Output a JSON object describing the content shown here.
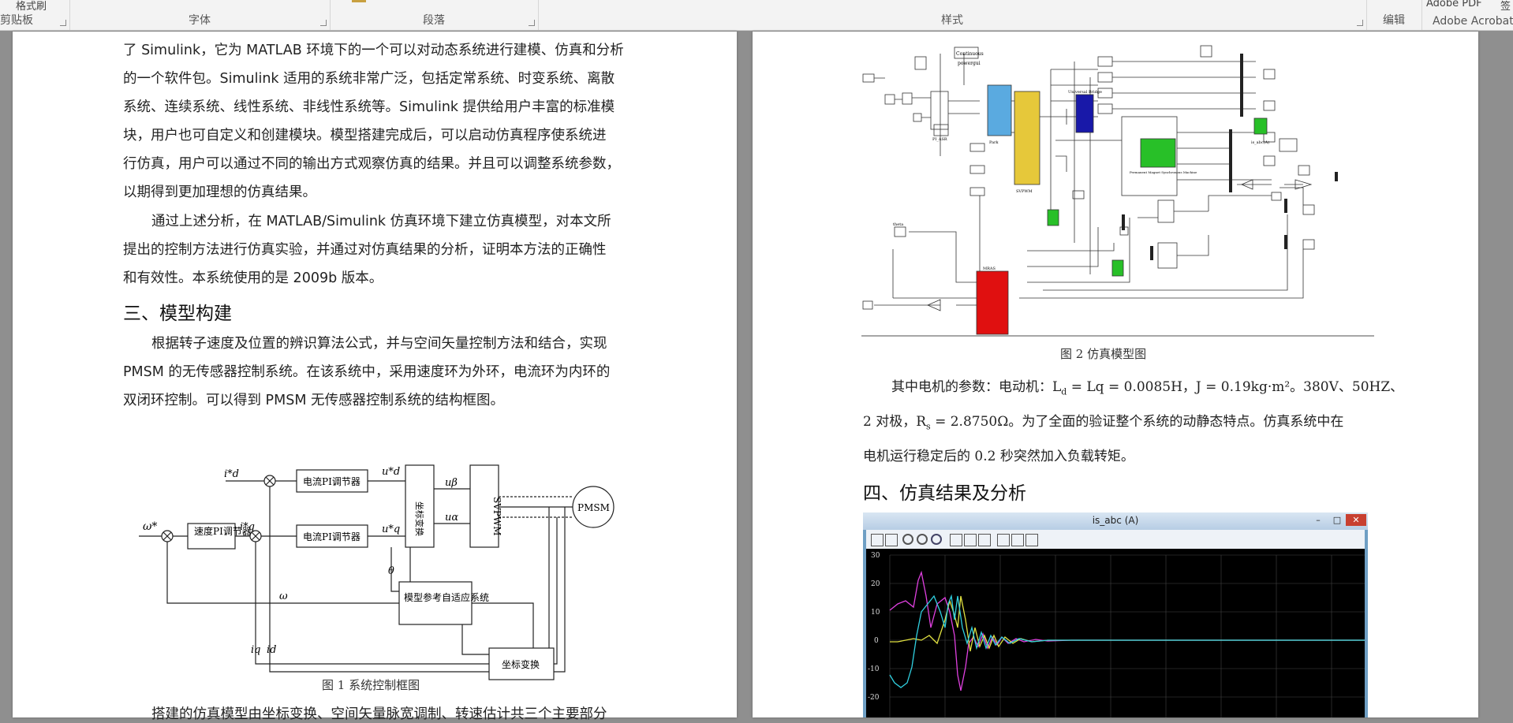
{
  "ribbon": {
    "groups": [
      {
        "label": "剪贴板"
      },
      {
        "label": "字体"
      },
      {
        "label": "段落"
      },
      {
        "label": "样式"
      },
      {
        "label": "编辑"
      },
      {
        "label": "Adobe Acrobat"
      }
    ],
    "top_fragments": [
      "格式刷",
      "Adobe PDF",
      "签"
    ]
  },
  "left_page": {
    "para1_lines": [
      "了 Simulink，它为 MATLAB 环境下的一个可以对动态系统进行建模、仿真和分析",
      "的一个软件包。Simulink 适用的系统非常广泛，包括定常系统、时变系统、离散",
      "系统、连续系统、线性系统、非线性系统等。Simulink 提供给用户丰富的标准模",
      "块，用户也可自定义和创建模块。模型搭建完成后，可以启动仿真程序使系统进",
      "行仿真，用户可以通过不同的输出方式观察仿真的结果。并且可以调整系统参数，",
      "以期得到更加理想的仿真结果。"
    ],
    "para2_lines": [
      "通过上述分析，在 MATLAB/Simulink 仿真环境下建立仿真模型，对本文所",
      "提出的控制方法进行仿真实验，并通过对仿真结果的分析，证明本方法的正确性",
      "和有效性。本系统使用的是 2009b 版本。"
    ],
    "heading3": "三、模型构建",
    "para3_lines": [
      "根据转子速度及位置的辨识算法公式，并与空间矢量控制方法和结合，实现",
      "PMSM 的无传感器控制系统。在该系统中，采用速度环为外环，电流环为内环的",
      "双闭环控制。可以得到 PMSM 无传感器控制系统的结构框图。"
    ],
    "diagram": {
      "speed_pi": "速度PI调节器",
      "current_pi": "电流PI调节器",
      "coord_transform": "坐标变换",
      "svpwm": "SVPWM",
      "pmsm": "PMSM",
      "mras": "模型参考自适应系统",
      "coord_transform2": "坐标变换"
    },
    "caption1": "图 1  系统控制框图",
    "bottom_line": "搭建的仿真模型由坐标变换、空间矢量脉宽调制、转速估计共三个主要部分"
  },
  "right_page": {
    "caption2": "图 2  仿真模型图",
    "param_line1": "其中电机的参数：电动机：L",
    "param_line1_rest": "= Lq = 0.0085H，J = 0.19kg·m²。380V、50HZ、",
    "param_line2": "2 对极，R",
    "param_line2_rest": "= 2.8750Ω。为了全面的验证整个系统的动静态特点。仿真系统中在",
    "param_line3": "电机运行稳定后的 0.2 秒突然加入负载转矩。",
    "heading4": "四、仿真结果及分析",
    "scope": {
      "title": "is_abc (A)",
      "yticks": [
        "30",
        "20",
        "10",
        "0",
        "-10",
        "-20"
      ]
    },
    "model": {
      "labels": [
        "Continuous",
        "powergui",
        "PI_ASR",
        "Park",
        "SVPWM",
        "DC",
        "Universal Bridge",
        "Permanent Magnet Synchronous Machine",
        "MRAS",
        "is_abc(A)",
        "N_eT",
        "Te",
        "theta"
      ]
    }
  },
  "colors": {
    "blue_block": "#5aaae0",
    "yellow_block": "#e6c83a",
    "navy_block": "#1818a8",
    "green_block": "#28c028",
    "red_block": "#e01010",
    "scope_magenta": "#e040e0",
    "scope_yellow": "#e0e040",
    "scope_cyan": "#30d0e0"
  }
}
